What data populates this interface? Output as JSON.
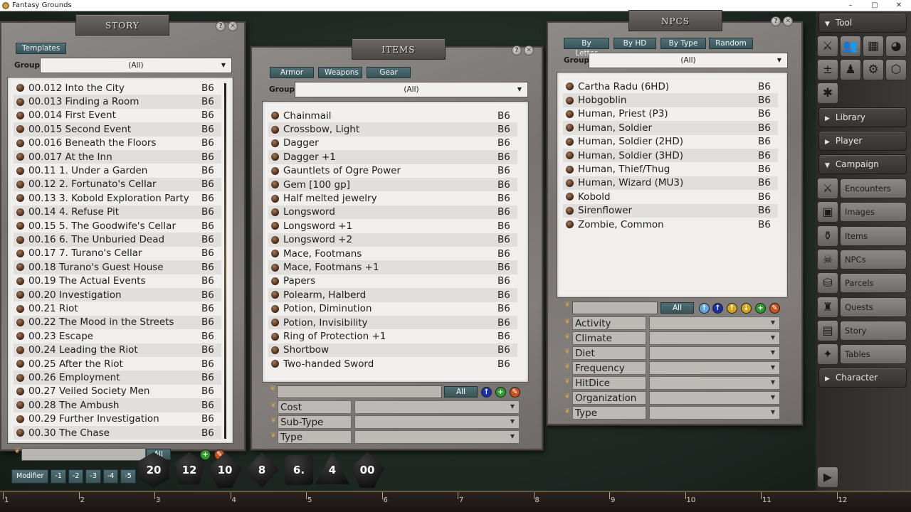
{
  "window": {
    "title": "Fantasy Grounds",
    "min": "–",
    "max": "▢",
    "close": "✕"
  },
  "story": {
    "title": "STORY",
    "templates_label": "Templates",
    "group_label": "Group",
    "group_value": "(All)",
    "items": [
      {
        "name": "00.012 Into the City",
        "tag": "B6"
      },
      {
        "name": "00.013 Finding a Room",
        "tag": "B6"
      },
      {
        "name": "00.014 First Event",
        "tag": "B6"
      },
      {
        "name": "00.015 Second Event",
        "tag": "B6"
      },
      {
        "name": "00.016 Beneath the Floors",
        "tag": "B6"
      },
      {
        "name": "00.017 At the Inn",
        "tag": "B6"
      },
      {
        "name": "00.11 1. Under a Garden",
        "tag": "B6"
      },
      {
        "name": "00.12 2. Fortunato's Cellar",
        "tag": "B6"
      },
      {
        "name": "00.13 3. Kobold Exploration Party",
        "tag": "B6"
      },
      {
        "name": "00.14 4. Refuse Pit",
        "tag": "B6"
      },
      {
        "name": "00.15 5. The Goodwife's Cellar",
        "tag": "B6"
      },
      {
        "name": "00.16 6. The Unburied Dead",
        "tag": "B6"
      },
      {
        "name": "00.17 7. Turano's Cellar",
        "tag": "B6"
      },
      {
        "name": "00.18 Turano's Guest House",
        "tag": "B6"
      },
      {
        "name": "00.19 The Actual Events",
        "tag": "B6"
      },
      {
        "name": "00.20 Investigation",
        "tag": "B6"
      },
      {
        "name": "00.21 Riot",
        "tag": "B6"
      },
      {
        "name": "00.22 The Mood in the Streets",
        "tag": "B6"
      },
      {
        "name": "00.23 Escape",
        "tag": "B6"
      },
      {
        "name": "00.24 Leading the Riot",
        "tag": "B6"
      },
      {
        "name": "00.25 After the Riot",
        "tag": "B6"
      },
      {
        "name": "00.26 Employment",
        "tag": "B6"
      },
      {
        "name": "00.27 Veiled Society Men",
        "tag": "B6"
      },
      {
        "name": "00.28 The Ambush",
        "tag": "B6"
      },
      {
        "name": "00.29 Further Investigation",
        "tag": "B6"
      },
      {
        "name": "00.30 The Chase",
        "tag": "B6"
      }
    ],
    "filter_all": "All"
  },
  "items": {
    "title": "ITEMS",
    "tabs": [
      "Armor",
      "Weapons",
      "Gear"
    ],
    "group_label": "Group",
    "group_value": "(All)",
    "list": [
      {
        "name": "Chainmail",
        "tag": "B6"
      },
      {
        "name": "Crossbow, Light",
        "tag": "B6"
      },
      {
        "name": "Dagger",
        "tag": "B6"
      },
      {
        "name": "Dagger +1",
        "tag": "B6"
      },
      {
        "name": "Gauntlets of Ogre Power",
        "tag": "B6"
      },
      {
        "name": "Gem [100 gp]",
        "tag": "B6"
      },
      {
        "name": "Half melted jewelry",
        "tag": "B6"
      },
      {
        "name": "Longsword",
        "tag": "B6"
      },
      {
        "name": "Longsword +1",
        "tag": "B6"
      },
      {
        "name": "Longsword +2",
        "tag": "B6"
      },
      {
        "name": "Mace, Footmans",
        "tag": "B6"
      },
      {
        "name": "Mace, Footmans +1",
        "tag": "B6"
      },
      {
        "name": "Papers",
        "tag": "B6"
      },
      {
        "name": "Polearm, Halberd",
        "tag": "B6"
      },
      {
        "name": "Potion, Diminution",
        "tag": "B6"
      },
      {
        "name": "Potion, Invisibility",
        "tag": "B6"
      },
      {
        "name": "Ring of Protection +1",
        "tag": "B6"
      },
      {
        "name": "Shortbow",
        "tag": "B6"
      },
      {
        "name": "Two-handed Sword",
        "tag": "B6"
      }
    ],
    "filter_all": "All",
    "filters": [
      "Cost",
      "Sub-Type",
      "Type"
    ]
  },
  "npcs": {
    "title": "NPCS",
    "tabs": [
      "By Letter",
      "By HD",
      "By Type",
      "Random"
    ],
    "group_label": "Group",
    "group_value": "(All)",
    "list": [
      {
        "name": "Cartha Radu (6HD)",
        "tag": "B6"
      },
      {
        "name": "Hobgoblin",
        "tag": "B6"
      },
      {
        "name": "Human, Priest (P3)",
        "tag": "B6"
      },
      {
        "name": "Human, Soldier",
        "tag": "B6"
      },
      {
        "name": "Human, Soldier (2HD)",
        "tag": "B6"
      },
      {
        "name": "Human, Soldier (3HD)",
        "tag": "B6"
      },
      {
        "name": "Human, Thief/Thug",
        "tag": "B6"
      },
      {
        "name": "Human, Wizard (MU3)",
        "tag": "B6"
      },
      {
        "name": "Kobold",
        "tag": "B6"
      },
      {
        "name": "Sirenflower",
        "tag": "B6"
      },
      {
        "name": "Zombie, Common",
        "tag": "B6"
      }
    ],
    "filter_all": "All",
    "filters": [
      "Activity",
      "Climate",
      "Diet",
      "Frequency",
      "HitDice",
      "Organization",
      "Type"
    ]
  },
  "sidebar": {
    "tool_label": "Tool",
    "library_label": "Library",
    "player_label": "Player",
    "campaign_label": "Campaign",
    "character_label": "Character",
    "campaign_buttons": [
      "Encounters",
      "Images",
      "Items",
      "NPCs",
      "Parcels",
      "Quests",
      "Story",
      "Tables"
    ]
  },
  "modifier": {
    "label": "Modifier",
    "values": [
      "-1",
      "-2",
      "-3",
      "-4",
      "-5"
    ]
  },
  "dice": [
    "20",
    "12",
    "10",
    "8",
    "6.",
    "4",
    "00"
  ],
  "ruler": [
    "1",
    "2",
    "3",
    "4",
    "5",
    "6",
    "7",
    "8",
    "9",
    "10",
    "11",
    "12"
  ],
  "colors": {
    "accent_tab": "#4f7076",
    "panel": "#837e7b",
    "list_bg": "#f0efed"
  }
}
